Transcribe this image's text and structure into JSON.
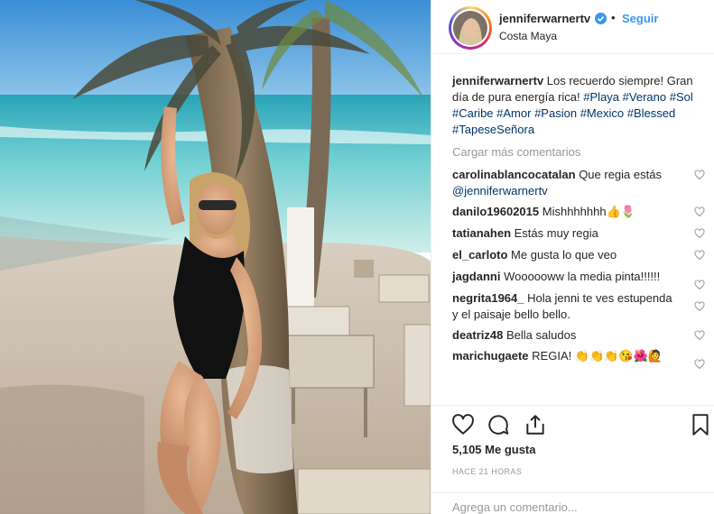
{
  "post": {
    "username": "jenniferwarnertv",
    "follow_label": "Seguir",
    "location": "Costa Maya",
    "dot": "•"
  },
  "caption": {
    "username": "jenniferwarnertv",
    "text": "Los recuerdo siempre! Gran día de pura energía rica!",
    "hashtags": [
      "#Playa",
      "#Verano",
      "#Sol",
      "#Caribe",
      "#Amor",
      "#Pasion",
      "#Mexico",
      "#Blessed",
      "#TapeseSeñora"
    ]
  },
  "load_more_label": "Cargar más comentarios",
  "comments": [
    {
      "user": "carolinablancocatalan",
      "text": "Que regia estás",
      "mention": "@jenniferwarnertv"
    },
    {
      "user": "danilo19602015",
      "text": "Mishhhhhhh👍🌷"
    },
    {
      "user": "tatianahen",
      "text": "Estás muy regia"
    },
    {
      "user": "el_carloto",
      "text": "Me gusta lo que veo"
    },
    {
      "user": "jagdanni",
      "text": "Woooooww la media pinta!!!!!!"
    },
    {
      "user": "negrita1964_",
      "text": "Hola jenni te ves estupenda y el paisaje bello bello."
    },
    {
      "user": "deatriz48",
      "text": "Bella saludos"
    },
    {
      "user": "marichugaete",
      "text": "REGIA! 👏👏👏😘🌺🙋"
    }
  ],
  "likes_text": "5,105 Me gusta",
  "timestamp": "HACE 21 HORAS",
  "add_comment_placeholder": "Agrega un comentario...",
  "colors": {
    "link_blue": "#3897f0",
    "hashtag": "#003569",
    "muted": "#999999",
    "border": "#efefef"
  },
  "icons": {
    "verified": "verified-badge-icon",
    "like": "heart-icon",
    "comment": "comment-bubble-icon",
    "share": "share-icon",
    "save": "bookmark-icon"
  }
}
